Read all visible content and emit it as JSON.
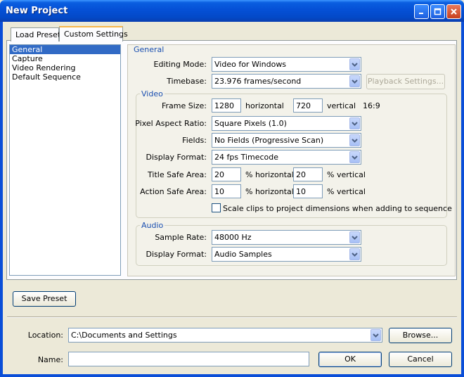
{
  "window": {
    "title": "New Project"
  },
  "tabs": [
    {
      "label": "Load Preset"
    },
    {
      "label": "Custom Settings"
    }
  ],
  "categories": [
    {
      "label": "General"
    },
    {
      "label": "Capture"
    },
    {
      "label": "Video Rendering"
    },
    {
      "label": "Default Sequence"
    }
  ],
  "general": {
    "group_title": "General",
    "editing_mode": {
      "label": "Editing Mode:",
      "value": "Video for Windows"
    },
    "timebase": {
      "label": "Timebase:",
      "value": "23.976 frames/second"
    },
    "playback_settings_label": "Playback Settings..."
  },
  "video": {
    "group_title": "Video",
    "frame_size": {
      "label": "Frame Size:",
      "width": "1280",
      "horizontal_label": "horizontal",
      "height": "720",
      "vertical_label": "vertical",
      "aspect": "16:9"
    },
    "pixel_aspect_ratio": {
      "label": "Pixel Aspect Ratio:",
      "value": "Square Pixels (1.0)"
    },
    "fields": {
      "label": "Fields:",
      "value": "No Fields (Progressive Scan)"
    },
    "display_format": {
      "label": "Display Format:",
      "value": "24 fps Timecode"
    },
    "title_safe": {
      "label": "Title Safe Area:",
      "horizontal": "20",
      "horizontal_label": "% horizontal",
      "vertical": "20",
      "vertical_label": "% vertical"
    },
    "action_safe": {
      "label": "Action Safe Area:",
      "horizontal": "10",
      "horizontal_label": "% horizontal",
      "vertical": "10",
      "vertical_label": "% vertical"
    },
    "scale_clips": {
      "label": "Scale clips to project dimensions when adding to sequence",
      "checked": false
    }
  },
  "audio": {
    "group_title": "Audio",
    "sample_rate": {
      "label": "Sample Rate:",
      "value": "48000 Hz"
    },
    "display_format": {
      "label": "Display Format:",
      "value": "Audio Samples"
    }
  },
  "save_preset_label": "Save Preset",
  "location": {
    "label": "Location:",
    "value": "C:\\Documents and Settings",
    "browse_label": "Browse..."
  },
  "name": {
    "label": "Name:",
    "value": ""
  },
  "ok_label": "OK",
  "cancel_label": "Cancel",
  "colors": {
    "titlebar": "#0550d6",
    "selection": "#316ac5",
    "group_title": "#1a4fb0",
    "dialog_bg": "#ece9d8"
  }
}
